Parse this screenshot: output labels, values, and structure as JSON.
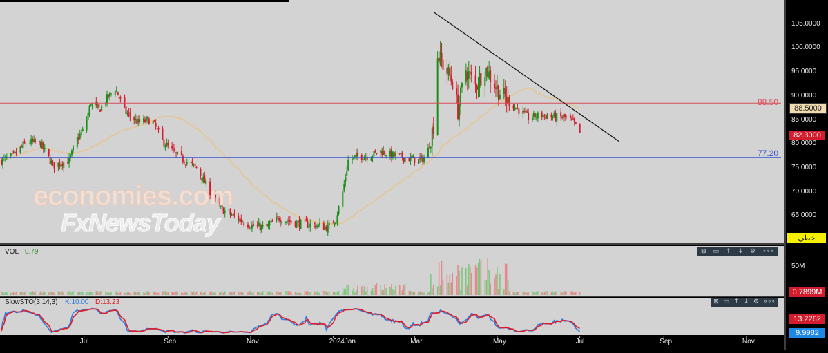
{
  "colors": {
    "up": "#1a8f1a",
    "down": "#d31c2c",
    "ma": "#e3c79a",
    "resistance": "#d94c5a",
    "support": "#3552d6",
    "trendline": "#111111",
    "k_line": "#2d7be0",
    "d_line": "#e01b24",
    "panel_bg": "#d3d3d3"
  },
  "watermark": {
    "line1": "economies.com",
    "line2": "FxNewsToday"
  },
  "price_labels": {
    "resistance": "88.50",
    "support": "77.20",
    "resistance_box": "88.5000",
    "current_box": "82.3000",
    "badge": "خطي"
  },
  "volume_panel": {
    "name": "VOL",
    "value": "0.79",
    "axis_label": "50M",
    "current_box": "0.7899M"
  },
  "stoch_panel": {
    "name": "SlowSTO(3,14,3)",
    "k_label": "K:10.00",
    "d_label": "D:13.23",
    "k_box": "9.9982",
    "d_box": "13.2262"
  },
  "panel_controls": [
    "⊠",
    "▭",
    "↑",
    "↓",
    "⚙",
    "∘∘∘"
  ],
  "chart_data": {
    "type": "candlestick",
    "y_ticks": [
      "105.0000",
      "100.0000",
      "95.0000",
      "90.0000",
      "85.0000",
      "80.0000",
      "75.0000",
      "70.0000",
      "65.0000"
    ],
    "x_ticks": [
      "Jul",
      "Sep",
      "Nov",
      "2024Jan",
      "Mar",
      "May",
      "Jul",
      "Sep",
      "Nov"
    ],
    "ylim": [
      59.3,
      110.0
    ],
    "horizontal_levels": {
      "resistance": 88.5,
      "support": 77.2
    },
    "trendline": {
      "from": {
        "date": "2024-03-15",
        "value": 107.5
      },
      "to": {
        "date": "2024-07-30",
        "value": 80.5
      }
    },
    "moving_average": "smooth overlay",
    "price_path": [
      [
        "2023-05-01",
        76.5
      ],
      [
        "2023-05-10",
        77.5
      ],
      [
        "2023-05-20",
        80.5
      ],
      [
        "2023-05-30",
        80
      ],
      [
        "2023-06-08",
        75.5
      ],
      [
        "2023-06-20",
        76.5
      ],
      [
        "2023-06-26",
        81
      ],
      [
        "2023-07-01",
        83
      ],
      [
        "2023-07-06",
        88.5
      ],
      [
        "2023-07-12",
        87
      ],
      [
        "2023-07-18",
        89.5
      ],
      [
        "2023-07-24",
        91.5
      ],
      [
        "2023-08-01",
        86.5
      ],
      [
        "2023-08-10",
        84.5
      ],
      [
        "2023-08-20",
        85
      ],
      [
        "2023-08-28",
        80.5
      ],
      [
        "2023-09-08",
        77.5
      ],
      [
        "2023-09-22",
        75
      ],
      [
        "2023-10-01",
        70.5
      ],
      [
        "2023-10-10",
        66.5
      ],
      [
        "2023-10-22",
        64.5
      ],
      [
        "2023-11-01",
        63
      ],
      [
        "2023-11-12",
        62.5
      ],
      [
        "2023-11-22",
        64.5
      ],
      [
        "2023-12-05",
        63.5
      ],
      [
        "2023-12-20",
        63
      ],
      [
        "2023-12-28",
        62.5
      ],
      [
        "2024-01-03",
        64.5
      ],
      [
        "2024-01-08",
        70
      ],
      [
        "2024-01-12",
        76.5
      ],
      [
        "2024-01-20",
        77.5
      ],
      [
        "2024-01-28",
        77.5
      ],
      [
        "2024-02-05",
        78.5
      ],
      [
        "2024-02-15",
        77.5
      ],
      [
        "2024-02-25",
        77
      ],
      [
        "2024-03-05",
        76.5
      ],
      [
        "2024-03-10",
        77.5
      ],
      [
        "2024-03-15",
        84
      ],
      [
        "2024-03-18",
        98.5
      ],
      [
        "2024-03-22",
        96.5
      ],
      [
        "2024-03-29",
        93
      ],
      [
        "2024-04-02",
        87
      ],
      [
        "2024-04-08",
        95.5
      ],
      [
        "2024-04-15",
        92
      ],
      [
        "2024-04-22",
        96
      ],
      [
        "2024-05-01",
        91.5
      ],
      [
        "2024-05-08",
        89
      ],
      [
        "2024-05-15",
        87.5
      ],
      [
        "2024-05-24",
        85.5
      ],
      [
        "2024-06-03",
        86
      ],
      [
        "2024-06-14",
        85.5
      ],
      [
        "2024-06-20",
        85.5
      ],
      [
        "2024-06-26",
        84.5
      ],
      [
        "2024-07-01",
        82.3
      ]
    ]
  }
}
